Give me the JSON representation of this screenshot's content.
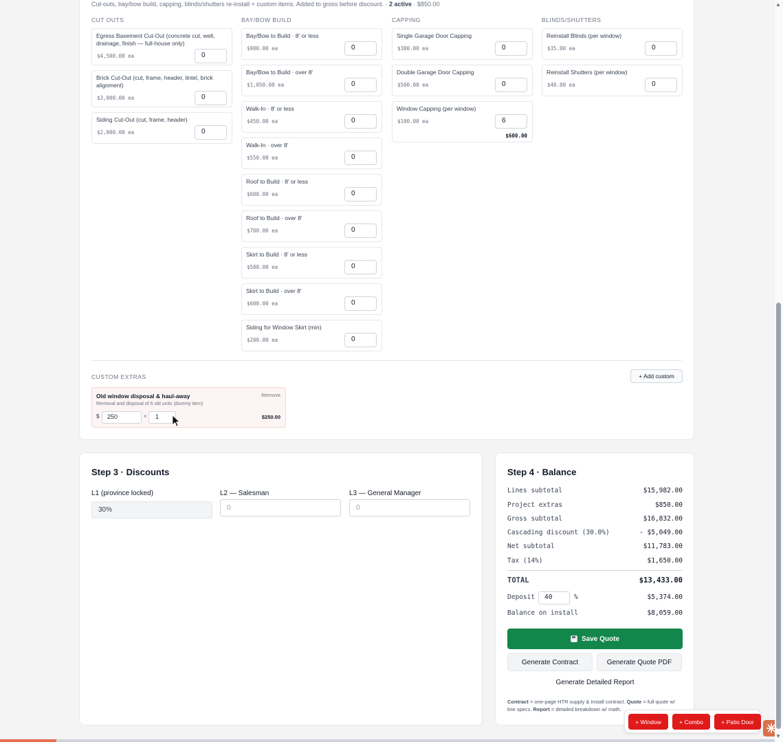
{
  "extras": {
    "intro_text": "Cut-outs, bay/bow build, capping, blinds/shutters re-install + custom items. Added to gross before discount. · ",
    "active_label": "2 active",
    "active_total": " · $850.00",
    "columns": [
      {
        "title": "CUT OUTS",
        "items": [
          {
            "name": "Egress Basement Cut-Out (concrete cut, well, drainage, finish — full-house only)",
            "price": "$4,500.00 ea",
            "qty": "0"
          },
          {
            "name": "Brick Cut-Out (cut, frame, header, lintel, brick alignment)",
            "price": "$3,000.00 ea",
            "qty": "0"
          },
          {
            "name": "Siding Cut-Out (cut, frame, header)",
            "price": "$2,000.00 ea",
            "qty": "0"
          }
        ]
      },
      {
        "title": "BAY/BOW BUILD",
        "items": [
          {
            "name": "Bay/Bow to Build · 8' or less",
            "price": "$900.00 ea",
            "qty": "0"
          },
          {
            "name": "Bay/Bow to Build · over 8'",
            "price": "$1,050.00 ea",
            "qty": "0"
          },
          {
            "name": "Walk-In · 8' or less",
            "price": "$450.00 ea",
            "qty": "0"
          },
          {
            "name": "Walk-In · over 8'",
            "price": "$550.00 ea",
            "qty": "0"
          },
          {
            "name": "Roof to Build · 8' or less",
            "price": "$600.00 ea",
            "qty": "0"
          },
          {
            "name": "Roof to Build · over 8'",
            "price": "$700.00 ea",
            "qty": "0"
          },
          {
            "name": "Skirt to Build · 8' or less",
            "price": "$500.00 ea",
            "qty": "0"
          },
          {
            "name": "Skirt to Build · over 8'",
            "price": "$600.00 ea",
            "qty": "0"
          },
          {
            "name": "Siding for Window Skirt (min)",
            "price": "$200.00 ea",
            "qty": "0"
          }
        ]
      },
      {
        "title": "CAPPING",
        "items": [
          {
            "name": "Single Garage Door Capping",
            "price": "$300.00 ea",
            "qty": "0"
          },
          {
            "name": "Double Garage Door Capping",
            "price": "$500.00 ea",
            "qty": "0"
          },
          {
            "name": "Window Capping (per window)",
            "price": "$100.00 ea",
            "qty": "6",
            "total": "$600.00"
          }
        ]
      },
      {
        "title": "BLINDS/SHUTTERS",
        "items": [
          {
            "name": "Reinstall Blinds (per window)",
            "price": "$35.00 ea",
            "qty": "0"
          },
          {
            "name": "Reinstall Shutters (per window)",
            "price": "$40.00 ea",
            "qty": "0"
          }
        ]
      }
    ],
    "custom": {
      "label": "CUSTOM EXTRAS",
      "add_button": "+ Add custom",
      "item": {
        "title": "Old window disposal & haul-away",
        "description": "Removal and disposal of 6 old units (dummy item)",
        "remove_label": "Remove",
        "currency": "$",
        "price": "250",
        "times": "×",
        "qty": "1",
        "total": "$250.00"
      }
    }
  },
  "discounts": {
    "title": "Step 3 · Discounts",
    "l1_label": "L1 (province locked)",
    "l1_value": "30%",
    "l2_label": "L2 — Salesman",
    "l2_placeholder": "0",
    "l3_label": "L3 — General Manager",
    "l3_placeholder": "0"
  },
  "balance": {
    "title": "Step 4 · Balance",
    "rows": [
      {
        "label": "Lines subtotal",
        "value": "$15,982.00"
      },
      {
        "label": "Project extras",
        "value": "$850.00"
      },
      {
        "label": "Gross subtotal",
        "value": "$16,832.00"
      },
      {
        "label": "Cascading discount (30.0%)",
        "value": "- $5,049.00"
      },
      {
        "label": "Net subtotal",
        "value": "$11,783.00"
      },
      {
        "label": "Tax (14%)",
        "value": "$1,650.00"
      }
    ],
    "total_label": "TOTAL",
    "total_value": "$13,433.00",
    "deposit_label": "Deposit",
    "deposit_value": "40",
    "deposit_unit": "%",
    "deposit_amount": "$5,374.00",
    "balance_label": "Balance on install",
    "balance_value": "$8,059.00",
    "save_label": "Save Quote",
    "contract_label": "Generate Contract",
    "pdf_label": "Generate Quote PDF",
    "report_label": "Generate Detailed Report",
    "footnote": {
      "contract_bold": "Contract",
      "contract_text": " = one-page HTR supply & install contract. ",
      "quote_bold": "Quote",
      "quote_text": " = full quote w/ line specs. ",
      "report_bold": "Report",
      "report_text": " = detailed breakdown w/ math."
    }
  },
  "fabs": {
    "window": "+ Window",
    "combo": "+ Combo",
    "patio": "+ Patio Door"
  },
  "progress": 0.073,
  "colors": {
    "save_green": "#13864b",
    "fab_red": "#e01a1a",
    "custom_bg": "#fdf5f4",
    "accent_orange": "#e76f51"
  }
}
